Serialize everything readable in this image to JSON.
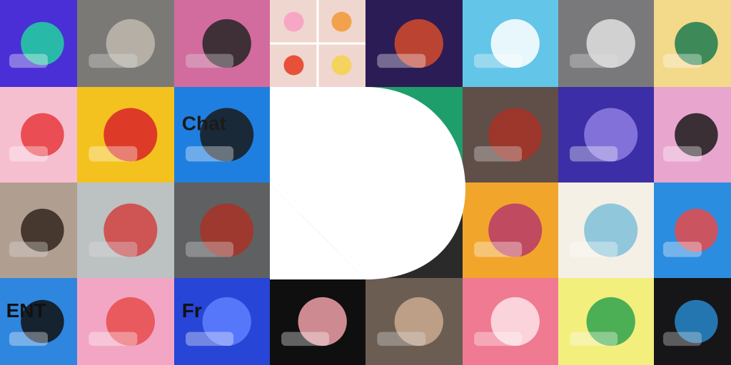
{
  "mosaic": {
    "columns": 8,
    "rows": 4,
    "logo_color": "#ffffff",
    "tiles": [
      {
        "name": "vr-phone-illustration-tile",
        "bg": "#4a2fd6",
        "accent": "#22d1a0",
        "kind": "illustration"
      },
      {
        "name": "vr-headset-photo-tile",
        "bg": "#8d8a86",
        "accent": "#d9d2c8",
        "kind": "photo"
      },
      {
        "name": "sparkler-phone-photo-tile",
        "bg": "#f07ab4",
        "accent": "#2a2a2a",
        "kind": "photo"
      },
      {
        "name": "food-icons-grid-tile",
        "bg": "#efd7cf",
        "accent": "#f2a14c",
        "kind": "icons"
      },
      {
        "name": "astronaut-helmet-tile",
        "bg": "#2b1c55",
        "accent": "#d44a2c",
        "kind": "illustration"
      },
      {
        "name": "pixel-speech-bubbles-tile",
        "bg": "#63c5e8",
        "accent": "#ffffff",
        "kind": "illustration"
      },
      {
        "name": "cat-jellyfish-sketch-tile",
        "bg": "#8a8a8e",
        "accent": "#ffffff",
        "kind": "photo"
      },
      {
        "name": "plant-hand-illustration-tile",
        "bg": "#f3d98a",
        "accent": "#1d7a4f",
        "kind": "illustration"
      },
      {
        "name": "rainbow-flags-tile",
        "bg": "#f5bfd0",
        "accent": "#e8383d",
        "kind": "illustration"
      },
      {
        "name": "pencils-illustration-tile",
        "bg": "#f4c21e",
        "accent": "#d8232a",
        "kind": "illustration"
      },
      {
        "name": "chat-app-screens-tile",
        "bg": "#1f7fe0",
        "accent": "#1a1a1a",
        "kind": "illustration",
        "text": "Chat"
      },
      {
        "name": "logo-background-tile-1",
        "bg": "#2a2a2a",
        "accent": "#2a2a2a",
        "kind": "plain"
      },
      {
        "name": "green-stripes-tile",
        "bg": "#1e9e6a",
        "accent": "#178a5b",
        "kind": "illustration"
      },
      {
        "name": "laughing-people-photo-tile",
        "bg": "#6d5a52",
        "accent": "#c0392b",
        "kind": "photo"
      },
      {
        "name": "video-call-illustration-tile",
        "bg": "#3c2ea6",
        "accent": "#8e7de0",
        "kind": "illustration"
      },
      {
        "name": "checklist-notes-tile",
        "bg": "#e8a6cf",
        "accent": "#1a1a1a",
        "kind": "illustration"
      },
      {
        "name": "hands-phone-photo-tile",
        "bg": "#c9b6a6",
        "accent": "#3b2a22",
        "kind": "photo"
      },
      {
        "name": "paper-boat-photo-tile",
        "bg": "#d7dcdd",
        "accent": "#f04a4a",
        "kind": "photo"
      },
      {
        "name": "two-women-photo-tile",
        "bg": "#6b6e70",
        "accent": "#c0392b",
        "kind": "photo"
      },
      {
        "name": "presentation-illustration-tile",
        "bg": "#7fc7c4",
        "accent": "#e2574c",
        "kind": "illustration"
      },
      {
        "name": "logo-background-tile-2",
        "bg": "#2a2a2a",
        "accent": "#2a2a2a",
        "kind": "plain"
      },
      {
        "name": "group-hug-illustration-tile",
        "bg": "#f2a52b",
        "accent": "#b73a6a",
        "kind": "illustration"
      },
      {
        "name": "wireframe-sketch-tile",
        "bg": "#f4f0e6",
        "accent": "#7fc0d8",
        "kind": "illustration"
      },
      {
        "name": "phone-notification-tile",
        "bg": "#2b8de0",
        "accent": "#e84a4a",
        "kind": "illustration"
      },
      {
        "name": "blue-lettering-tile",
        "bg": "#2e86de",
        "accent": "#111111",
        "kind": "illustration",
        "text": "ENT"
      },
      {
        "name": "maze-cylinder-tile",
        "bg": "#f2a6c4",
        "accent": "#e84c4c",
        "kind": "illustration"
      },
      {
        "name": "blue-hand-lettering-tile",
        "bg": "#2745d6",
        "accent": "#5f80ff",
        "kind": "illustration",
        "text": "Fr"
      },
      {
        "name": "pink-abstract-shapes-tile",
        "bg": "#0f0f0f",
        "accent": "#f0a0a8",
        "kind": "illustration"
      },
      {
        "name": "fist-bump-photo-tile",
        "bg": "#7a6a5e",
        "accent": "#e7c3a3",
        "kind": "photo"
      },
      {
        "name": "pink-product-tile",
        "bg": "#f07a92",
        "accent": "#fbe3e8",
        "kind": "illustration"
      },
      {
        "name": "green-monster-tile",
        "bg": "#f2ef7d",
        "accent": "#2fa34e",
        "kind": "illustration"
      },
      {
        "name": "smart-speaker-photo-tile",
        "bg": "#1a1a1c",
        "accent": "#2e9be8",
        "kind": "photo"
      }
    ]
  }
}
